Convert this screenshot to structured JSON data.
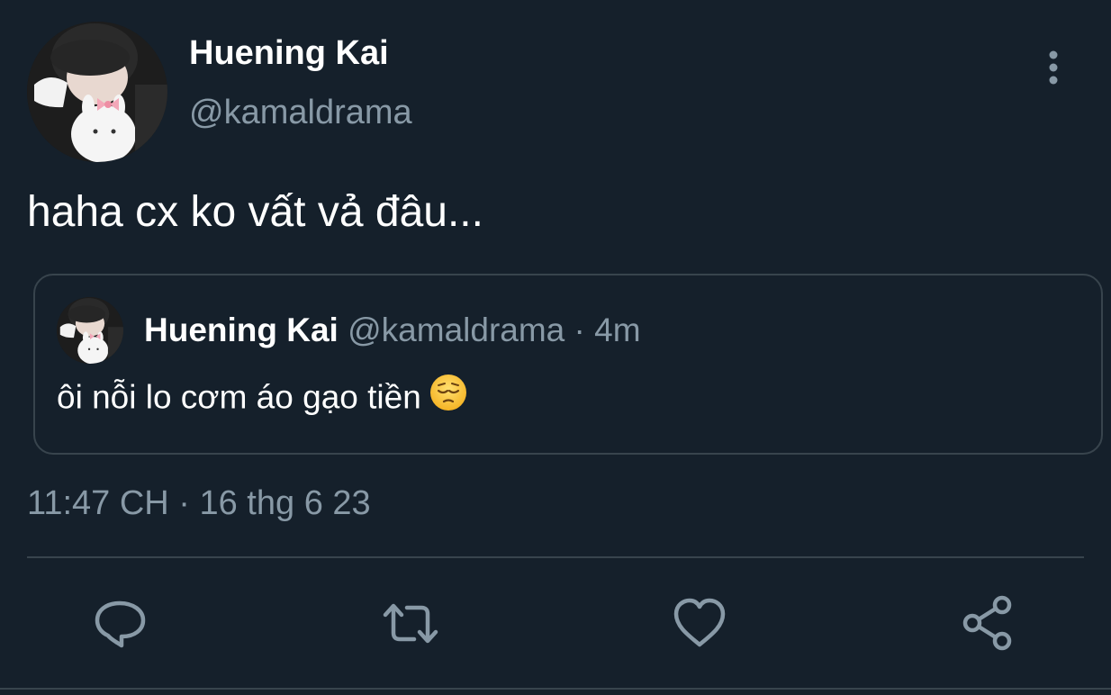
{
  "tweet": {
    "author": {
      "display_name": "Huening Kai",
      "handle": "@kamaldrama"
    },
    "text": "haha cx ko vất vả đâu...",
    "timestamp": "11:47 CH · 16 thg 6 23",
    "quoted": {
      "display_name": "Huening Kai",
      "handle": "@kamaldrama",
      "separator": "·",
      "age": "4m",
      "text": "ôi nỗi lo cơm áo gạo tiền",
      "emoji": "pensive-face"
    }
  },
  "icons": {
    "more": "more-vertical-icon",
    "reply": "reply-icon",
    "retweet": "retweet-icon",
    "like": "heart-icon",
    "share": "share-icon"
  },
  "colors": {
    "background": "#15202b",
    "primary_text": "#ffffff",
    "secondary_text": "#8899a6",
    "border": "#38444d"
  }
}
